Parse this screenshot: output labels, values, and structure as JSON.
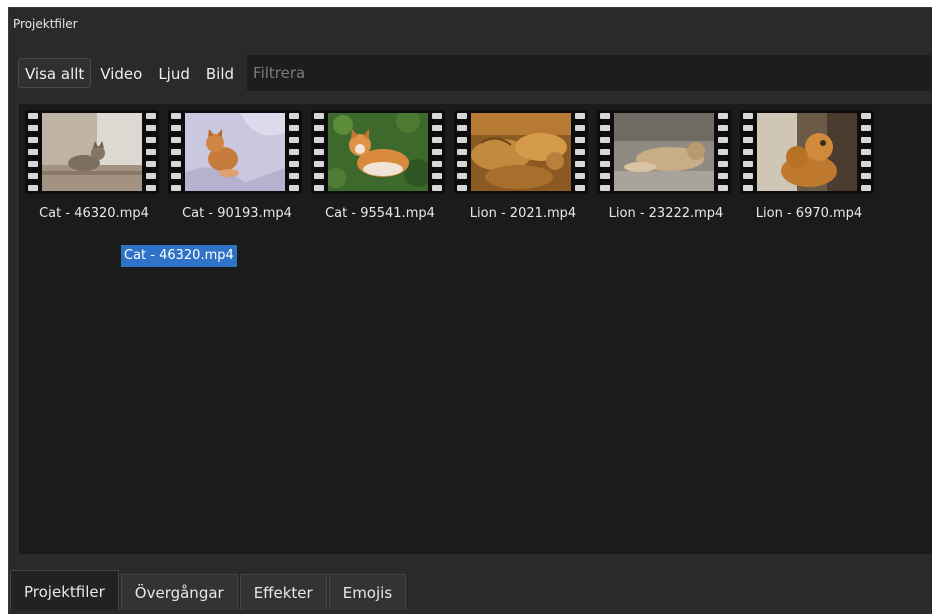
{
  "panel": {
    "title": "Projektfiler"
  },
  "filter": {
    "buttons": [
      "Visa allt",
      "Video",
      "Ljud",
      "Bild"
    ],
    "active_index": 0,
    "placeholder": "Filtrera"
  },
  "files": [
    {
      "name": "Cat - 46320.mp4",
      "thumbnail": "cat-on-bench"
    },
    {
      "name": "Cat - 90193.mp4",
      "thumbnail": "orange-cat-on-blanket"
    },
    {
      "name": "Cat - 95541.mp4",
      "thumbnail": "orange-cat-in-grass"
    },
    {
      "name": "Lion - 2021.mp4",
      "thumbnail": "lions-lying"
    },
    {
      "name": "Lion - 23222.mp4",
      "thumbnail": "lioness-resting"
    },
    {
      "name": "Lion - 6970.mp4",
      "thumbnail": "lion-cubs"
    }
  ],
  "drag_label": "Cat - 46320.mp4",
  "tabs": [
    "Projektfiler",
    "Övergångar",
    "Effekter",
    "Emojis"
  ],
  "active_tab": 0,
  "colors": {
    "background": "#2a2a2a",
    "file_area": "#1b1b1b",
    "selection": "#2f73c9"
  }
}
